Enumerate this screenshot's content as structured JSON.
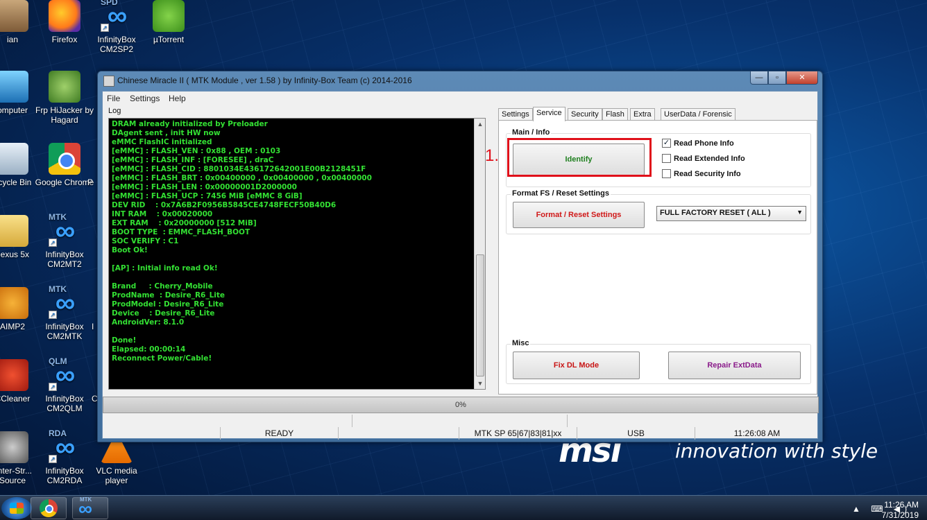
{
  "desktop": {
    "icons": [
      {
        "label": "ian"
      },
      {
        "label": "Firefox"
      },
      {
        "label": "InfinityBox CM2SP2",
        "tag": "SPD"
      },
      {
        "label": "µTorrent"
      },
      {
        "label": "omputer"
      },
      {
        "label": "Frp HiJacker by Hagard",
        "badge": "FRP"
      },
      {
        "label": "ecycle Bin"
      },
      {
        "label": "Google Chrome"
      },
      {
        "label": "P"
      },
      {
        "label": "nexus 5x"
      },
      {
        "label": "InfinityBox CM2MT2",
        "tag": "MTK"
      },
      {
        "label": "AIMP2"
      },
      {
        "label": "InfinityBox CM2MTK",
        "tag": "MTK"
      },
      {
        "label": "I"
      },
      {
        "label": "CCleaner"
      },
      {
        "label": "InfinityBox CM2QLM",
        "tag": "QLM"
      },
      {
        "label": "C"
      },
      {
        "label": "unter-Str... Source"
      },
      {
        "label": "InfinityBox CM2RDA",
        "tag": "RDA"
      },
      {
        "label": "VLC media player"
      }
    ],
    "brand_logo": "msi",
    "brand_tagline": "innovation with style"
  },
  "window": {
    "title": "Chinese Miracle II ( MTK Module , ver 1.58 ) by Infinity-Box Team (c) 2014-2016",
    "controls": {
      "minimize": "—",
      "maximize": "▫",
      "close": "✕"
    },
    "menu": [
      "File",
      "Settings",
      "Help"
    ],
    "log_label": "Log",
    "log_lines": [
      "DRAM already initialized by Preloader",
      "DAgent sent , init HW now",
      "eMMC FlashIC initialized",
      "[eMMC] : FLASH_VEN : 0x88 , OEM : 0103",
      "[eMMC] : FLASH_INF : [FORESEE] , draC",
      "[eMMC] : FLASH_CID : 8801034E436172642001E00B2128451F",
      "[eMMC] : FLASH_BRT : 0x00400000 , 0x00400000 , 0x00400000",
      "[eMMC] : FLASH_LEN : 0x00000001D2000000",
      "[eMMC] : FLASH_UCP : 7456 MiB [eMMC 8 GiB]",
      "DEV RID    : 0x7A6B2F0956B5845CE4748FECF50B40D6",
      "INT RAM    : 0x00020000",
      "EXT RAM    : 0x20000000 [512 MiB]",
      "BOOT TYPE  : EMMC_FLASH_BOOT",
      "SOC VERIFY : C1",
      "Boot Ok!",
      "",
      "[AP] : Initial info read Ok!",
      "",
      "Brand     : Cherry_Mobile",
      "ProdName  : Desire_R6_Lite",
      "ProdModel : Desire_R6_Lite",
      "Device    : Desire_R6_Lite",
      "AndroidVer: 8.1.0",
      "",
      "Done!",
      "Elapsed: 00:00:14",
      "Reconnect Power/Cable!"
    ],
    "tabs": [
      "Settings",
      "Service",
      "Security",
      "Flash",
      "Extra",
      "UserData / Forensic"
    ],
    "active_tab": "Service",
    "main_info": {
      "title": "Main / Info",
      "identify_label": "Identify",
      "checkboxes": [
        {
          "label": "Read Phone Info",
          "checked": true
        },
        {
          "label": "Read Extended Info",
          "checked": false
        },
        {
          "label": "Read Security Info",
          "checked": false
        }
      ]
    },
    "format": {
      "title": "Format FS / Reset Settings",
      "button_label": "Format / Reset Settings",
      "selected_option": "FULL FACTORY RESET ( ALL )"
    },
    "misc": {
      "title": "Misc",
      "fix_dl_label": "Fix DL Mode",
      "repair_label": "Repair ExtData"
    },
    "annotation_step": "1.",
    "progress": {
      "value": 0,
      "label": "0%"
    },
    "status": {
      "state": "READY",
      "sp": "MTK SP 65|67|83|81|xx",
      "port": "USB",
      "time": "11:26:08 AM"
    }
  },
  "colors": {
    "log_text": "#33e033",
    "identify_text": "#1e7f1e",
    "format_text": "#d01818",
    "fix_dl_text": "#c81414",
    "repair_text": "#8a1a8a",
    "highlight": "#e0101a"
  },
  "taskbar": {
    "apps": [
      {
        "icon": "chrome-icon"
      },
      {
        "icon": "infinity-box-icon",
        "tag": "MTK"
      }
    ],
    "tray_icons": "▲ ⌨ ◀)",
    "clock_time": "11:26 AM",
    "clock_date": "7/31/2019"
  }
}
